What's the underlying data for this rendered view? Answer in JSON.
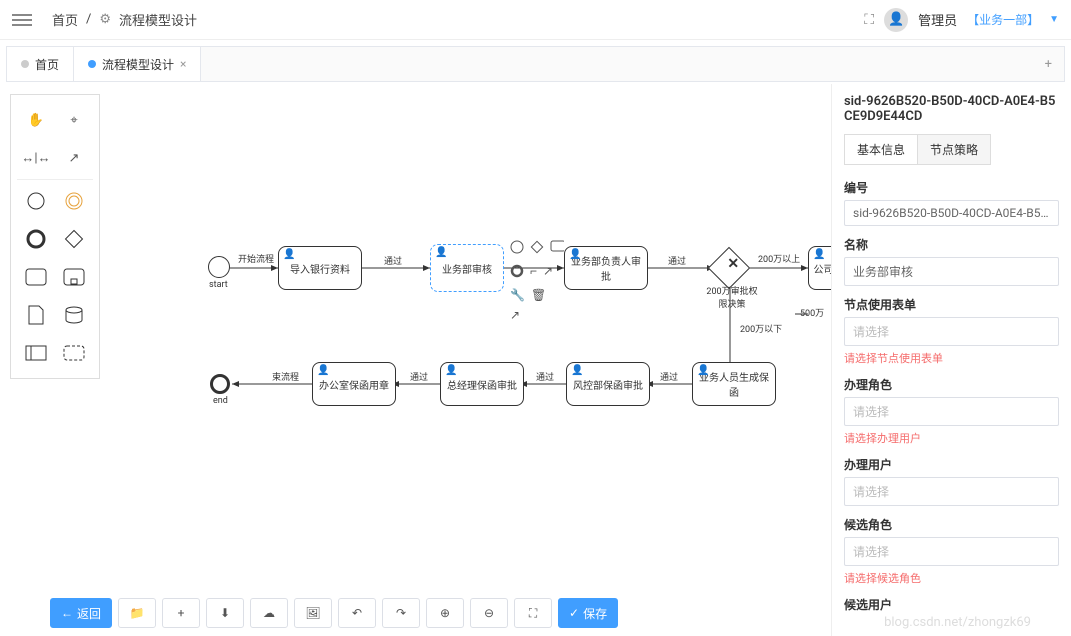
{
  "breadcrumb": {
    "home": "首页",
    "sep": "/",
    "page": "流程模型设计"
  },
  "user": {
    "name": "管理员",
    "org": "【业务一部】"
  },
  "tabs": [
    {
      "label": "首页",
      "color": "#ccc",
      "closable": false
    },
    {
      "label": "流程模型设计",
      "color": "#409eff",
      "closable": true
    }
  ],
  "panel": {
    "title": "sid-9626B520-B50D-40CD-A0E4-B5CE9D9E44CD",
    "tabs": [
      "基本信息",
      "节点策略"
    ],
    "fields": {
      "id_label": "编号",
      "id_value": "sid-9626B520-B50D-40CD-A0E4-B5CE9D9E44CD",
      "name_label": "名称",
      "name_value": "业务部审核",
      "form_label": "节点使用表单",
      "form_placeholder": "请选择",
      "form_error": "请选择节点使用表单",
      "role_label": "办理角色",
      "role_placeholder": "请选择",
      "role_error": "请选择办理用户",
      "user_label": "办理用户",
      "user_placeholder": "请选择",
      "cand_role_label": "候选角色",
      "cand_role_placeholder": "请选择",
      "cand_role_error": "请选择候选角色",
      "cand_user_label": "候选用户"
    }
  },
  "buttons": {
    "back": "返回",
    "save": "保存"
  },
  "nodes": {
    "start": "start",
    "end": "end",
    "start_edge": "开始流程",
    "end_edge": "束流程",
    "n1": "导入银行资料",
    "e1": "通过",
    "n2": "业务部审核",
    "e2": "通过",
    "n3": "业务部负责人审批",
    "e3": "通过",
    "n5": "公司评",
    "gw_label": "200万审批权限决策",
    "gw_up": "200万以上",
    "gw_down": "200万以下",
    "gw_right": "500万",
    "n6": "业务人员生成保函",
    "e6": "通过",
    "n7": "风控部保函审批",
    "e7": "通过",
    "n8": "总经理保函审批",
    "e8": "通过",
    "n9": "办公室保函用章"
  },
  "watermark": "blog.csdn.net/zhongzk69"
}
